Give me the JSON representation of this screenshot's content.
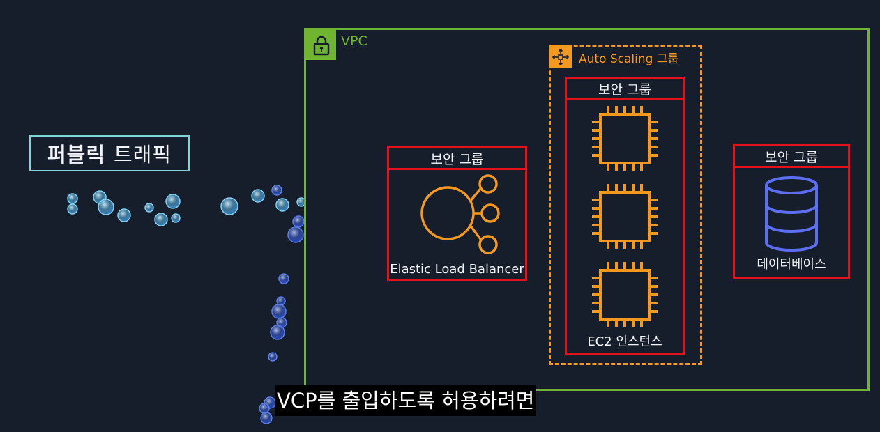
{
  "public_traffic": {
    "bold": "퍼블릭",
    "normal": "트래픽"
  },
  "vpc": {
    "label": "VPC",
    "icon": "lock-icon",
    "color": "#6fb531"
  },
  "auto_scaling": {
    "label": "Auto Scaling 그룹",
    "icon": "auto-scaling-icon",
    "color": "#f39a1e"
  },
  "security_groups": {
    "elb": {
      "header": "보안 그룹",
      "caption": "Elastic Load Balancer",
      "icon": "load-balancer-icon"
    },
    "ec2": {
      "header": "보안 그룹",
      "caption": "EC2 인스턴스",
      "icon": "ec2-chip-icon"
    },
    "db": {
      "header": "보안 그룹",
      "caption": "데이터베이스",
      "icon": "database-icon"
    },
    "border_color": "#e4101b"
  },
  "subtitle": "VCP를 출입하도록 허용하려면"
}
